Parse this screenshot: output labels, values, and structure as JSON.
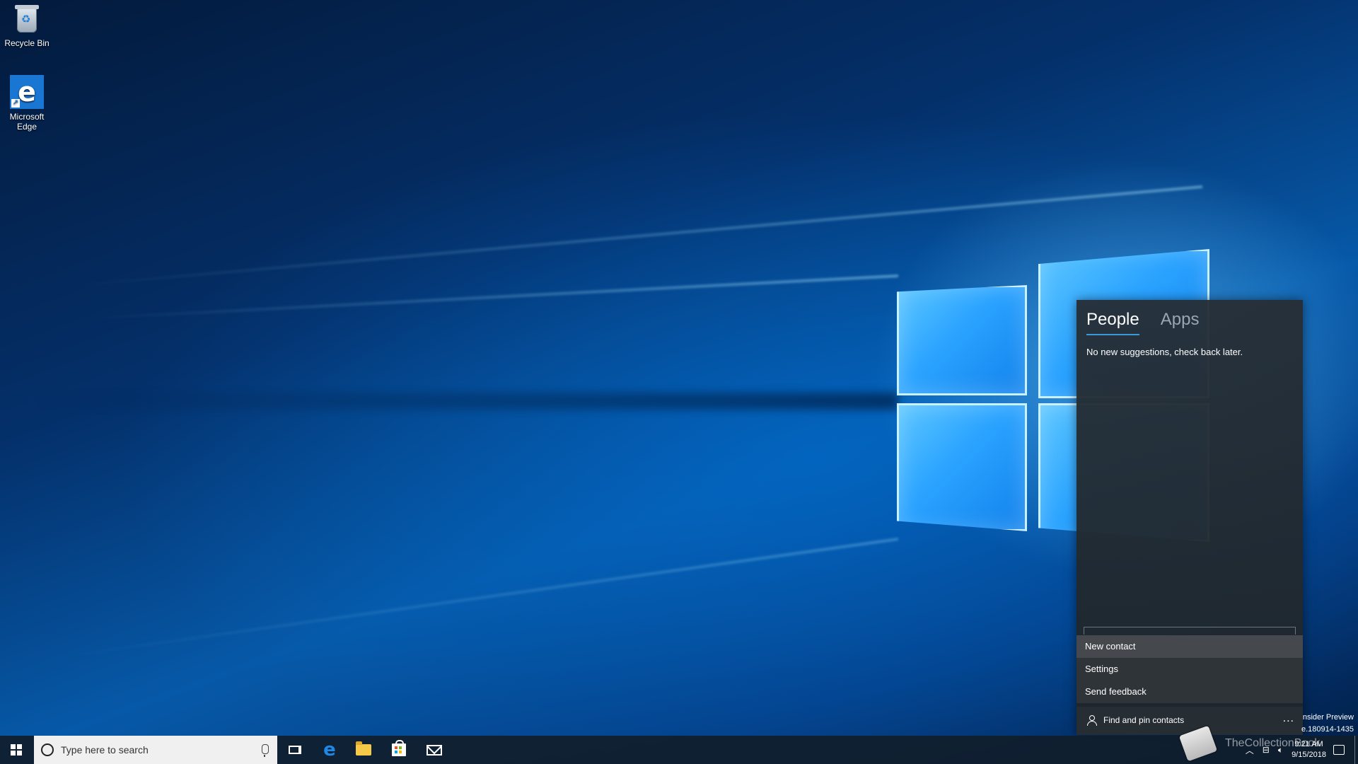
{
  "desktop": {
    "icons": [
      {
        "label": "Recycle Bin",
        "icon": "recycle-bin-icon"
      },
      {
        "label": "Microsoft Edge",
        "icon": "edge-icon"
      }
    ]
  },
  "people_flyout": {
    "tabs": [
      {
        "label": "People",
        "active": true
      },
      {
        "label": "Apps",
        "active": false
      }
    ],
    "suggestion_text": "No new suggestions, check back later.",
    "menu": [
      {
        "label": "New contact",
        "highlighted": true
      },
      {
        "label": "Settings",
        "highlighted": false
      },
      {
        "label": "Send feedback",
        "highlighted": false
      }
    ],
    "footer": {
      "find_label": "Find and pin contacts",
      "more_label": "..."
    }
  },
  "watermark": {
    "line1": "nsider Preview",
    "line2": "e.180914-1435"
  },
  "taskbar": {
    "search_placeholder": "Type here to search",
    "pinned": [
      "task-view-icon",
      "edge-icon",
      "file-explorer-icon",
      "store-icon",
      "mail-icon"
    ],
    "tray": {
      "time": "9:21 AM",
      "date": "9/15/2018"
    },
    "logo_watermark": "TheCollectionBook"
  },
  "colors": {
    "accent": "#3a9ad9",
    "taskbar": "#101e2c",
    "flyout": "#262e36"
  }
}
